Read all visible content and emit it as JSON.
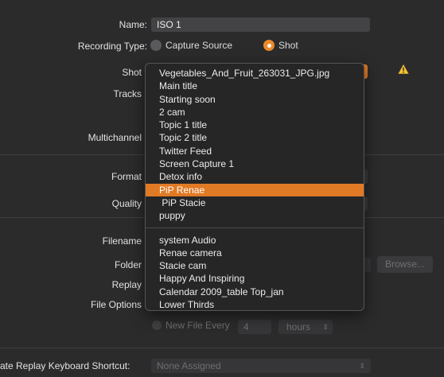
{
  "form": {
    "name_label": "Name:",
    "name_value": "ISO 1",
    "recording_type_label": "Recording Type:",
    "recording_options": [
      "Capture Source",
      "Shot"
    ],
    "recording_selected": "Shot",
    "shot_label": "Shot",
    "tracks_label": "Tracks",
    "multichannel_label": "Multichannel",
    "format_label": "Format",
    "quality_label": "Quality",
    "filename_label": "Filename",
    "folder_label": "Folder",
    "browse_label": "Browse...",
    "replay_label": "Replay",
    "file_options_label": "File Options",
    "new_file_every_label": "New File Every",
    "new_file_every_value": "4",
    "unit_value": "hours",
    "shortcut_label": "ate Replay Keyboard Shortcut:",
    "shortcut_value": "None Assigned"
  },
  "menu": {
    "group1": [
      "Vegetables_And_Fruit_263031_JPG.jpg",
      "Main title",
      "Starting soon",
      "2 cam",
      "Topic 1 title",
      "Topic 2 title",
      "Twitter Feed",
      "Screen Capture 1",
      "Detox info",
      "PiP Renae",
      " PiP Stacie",
      "puppy"
    ],
    "selected_index": 9,
    "group2": [
      "system Audio",
      "Renae camera",
      "Stacie cam",
      "Happy And Inspiring",
      "Calendar 2009_table Top_jan",
      "Lower Thirds"
    ]
  },
  "icons": {
    "warning": "warning-icon",
    "chevron": "updown-chevron-icon"
  },
  "colors": {
    "accent": "#e17a25",
    "warning": "#f2c12e",
    "background": "#2b2b2c"
  }
}
